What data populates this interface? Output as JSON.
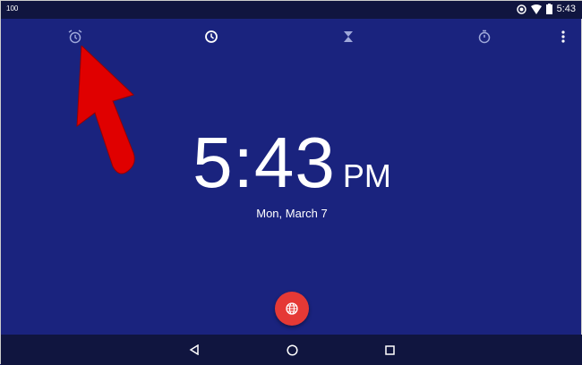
{
  "status": {
    "battery_pct": "100",
    "time": "5:43"
  },
  "tabs": [
    "alarm",
    "clock",
    "timer",
    "stopwatch"
  ],
  "clock": {
    "time": "5:43",
    "ampm": "PM",
    "date": "Mon, March 7"
  },
  "colors": {
    "background": "#1a237e",
    "fab": "#e53935",
    "arrow": "#e00000"
  }
}
